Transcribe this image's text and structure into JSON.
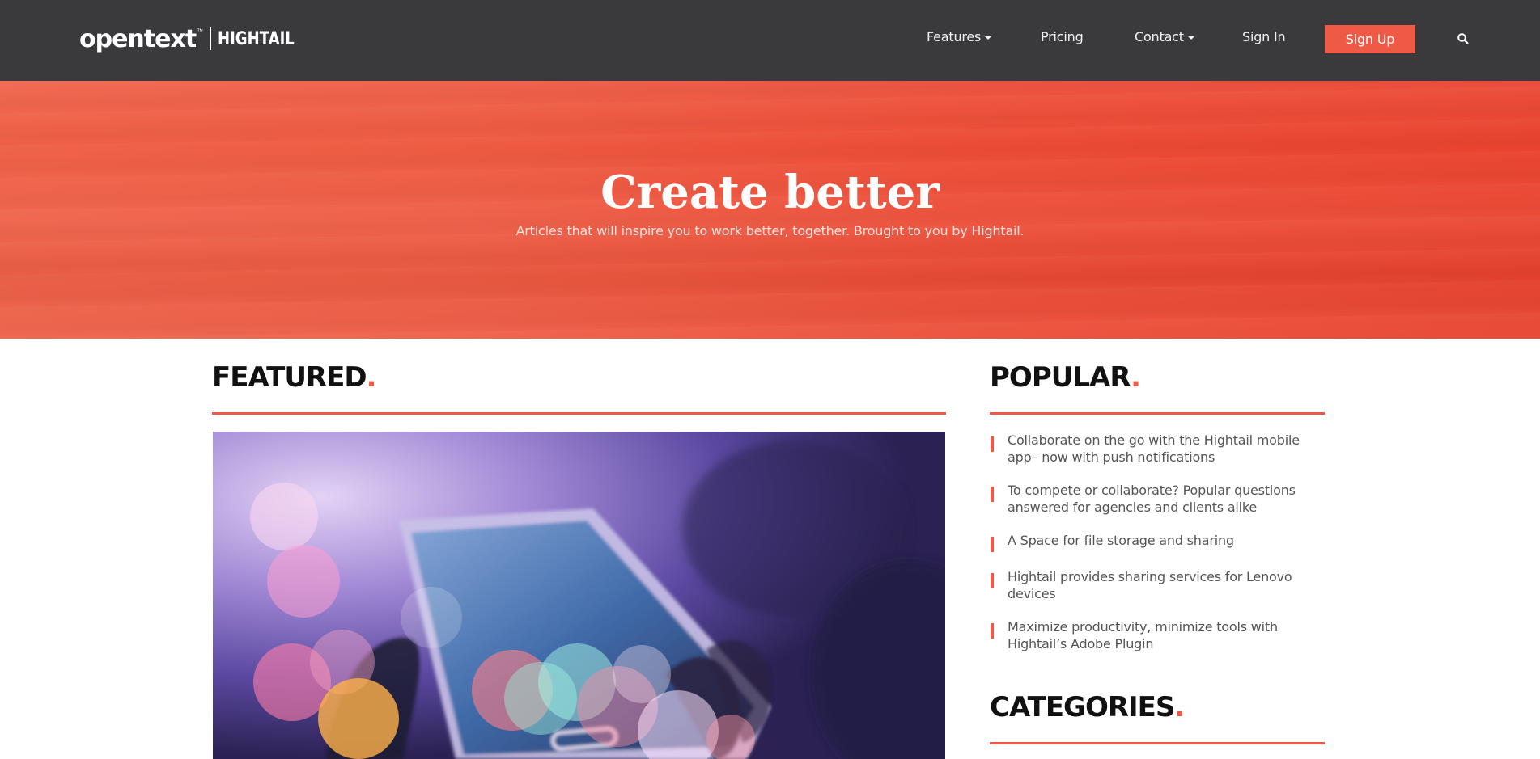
{
  "header": {
    "logo": {
      "opentext": "opentext",
      "tm": "™",
      "hightail": "HIGHTAIL"
    },
    "nav": [
      {
        "label": "Features",
        "dropdown": true
      },
      {
        "label": "Pricing",
        "dropdown": false
      },
      {
        "label": "Contact",
        "dropdown": true
      },
      {
        "label": "Sign In",
        "dropdown": false
      }
    ],
    "signup_label": "Sign Up",
    "search_icon": "search-icon"
  },
  "hero": {
    "title": "Create better",
    "subtitle": "Articles that will inspire you to work better, together. Brought to you by Hightail."
  },
  "featured": {
    "heading": "FEATURED",
    "dot": "."
  },
  "popular": {
    "heading": "POPULAR",
    "dot": ".",
    "items": [
      "Collaborate on the go with the Hightail mobile app– now with push notifications",
      "To compete or collaborate? Popular questions answered for agencies and clients alike",
      "A Space for file storage and sharing",
      "Hightail provides sharing services for Lenovo devices",
      "Maximize productivity, minimize tools with Hightail’s Adobe Plugin"
    ]
  },
  "categories": {
    "heading": "CATEGORIES",
    "dot": "."
  },
  "colors": {
    "accent": "#ee5a45",
    "topbar": "#3a3a3c",
    "hero": "#ec4d37"
  }
}
